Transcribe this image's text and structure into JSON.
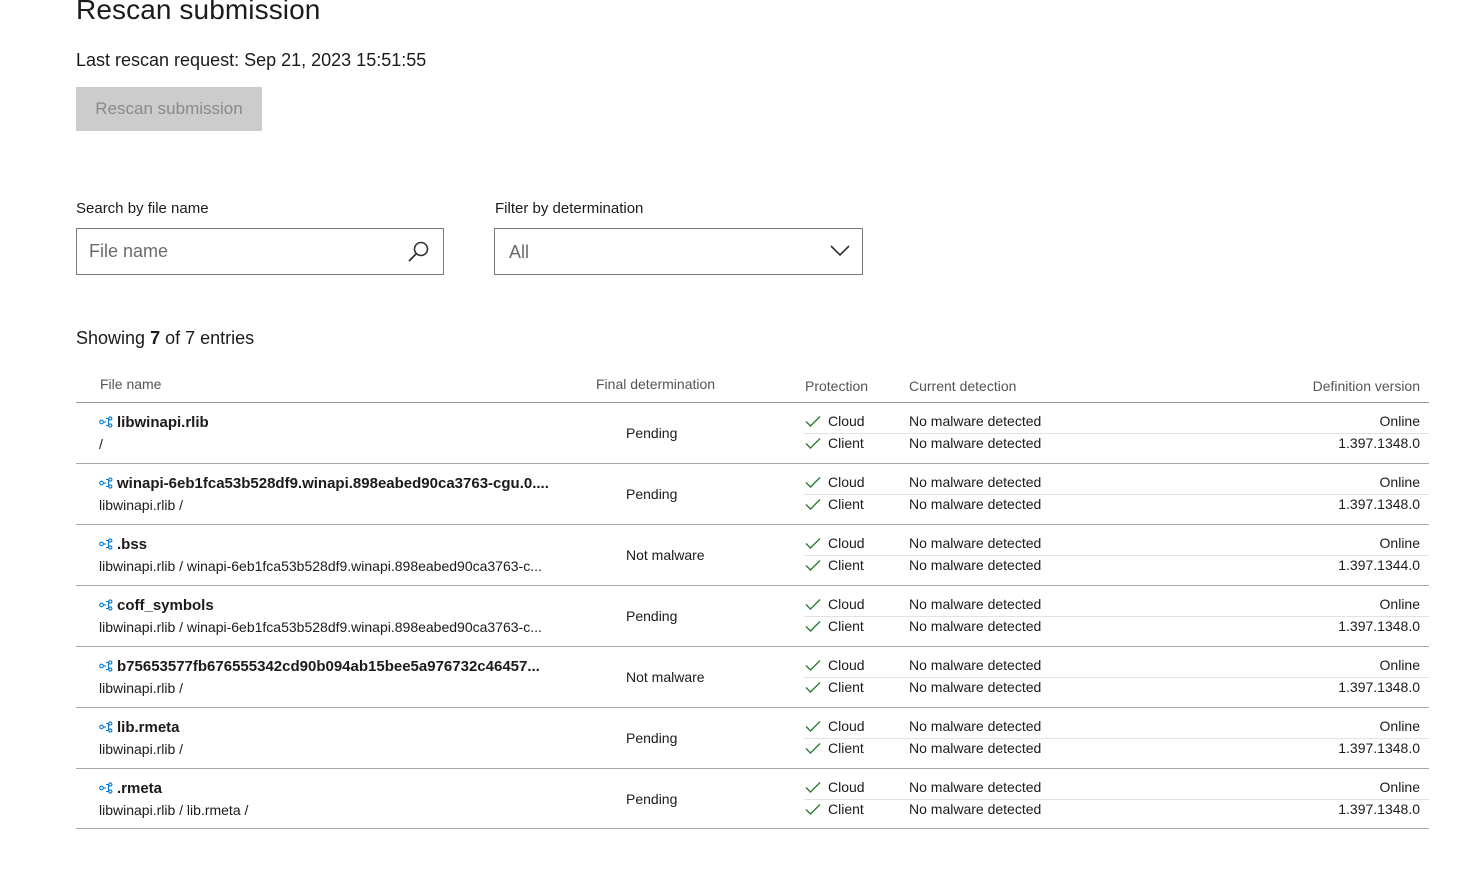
{
  "header": {
    "title": "Rescan submission",
    "last_rescan": "Last rescan request: Sep 21, 2023 15:51:55",
    "rescan_button": "Rescan submission"
  },
  "search": {
    "label": "Search by file name",
    "placeholder": "File name",
    "icon": "search-icon"
  },
  "filter": {
    "label": "Filter by determination",
    "value": "All",
    "icon": "chevron-down-icon"
  },
  "summary": {
    "prefix": "Showing",
    "shown": "7",
    "middle": "of 7 entries"
  },
  "table": {
    "columns": {
      "file_name": "File name",
      "final_determination": "Final determination",
      "protection": "Protection",
      "current_detection": "Current detection",
      "definition_version": "Definition version"
    },
    "rows": [
      {
        "name": "libwinapi.rlib",
        "path": "/",
        "determination": "Pending",
        "prot1": "Cloud",
        "prot2": "Client",
        "det1": "No malware detected",
        "det2": "No malware detected",
        "def1": "Online",
        "def2": "1.397.1348.0"
      },
      {
        "name": "winapi-6eb1fca53b528df9.winapi.898eabed90ca3763-cgu.0....",
        "path": "libwinapi.rlib /",
        "determination": "Pending",
        "prot1": "Cloud",
        "prot2": "Client",
        "det1": "No malware detected",
        "det2": "No malware detected",
        "def1": "Online",
        "def2": "1.397.1348.0"
      },
      {
        "name": ".bss",
        "path": "libwinapi.rlib / winapi-6eb1fca53b528df9.winapi.898eabed90ca3763-c...",
        "determination": "Not malware",
        "prot1": "Cloud",
        "prot2": "Client",
        "det1": "No malware detected",
        "det2": "No malware detected",
        "def1": "Online",
        "def2": "1.397.1344.0"
      },
      {
        "name": "coff_symbols",
        "path": "libwinapi.rlib / winapi-6eb1fca53b528df9.winapi.898eabed90ca3763-c...",
        "determination": "Pending",
        "prot1": "Cloud",
        "prot2": "Client",
        "det1": "No malware detected",
        "det2": "No malware detected",
        "def1": "Online",
        "def2": "1.397.1348.0"
      },
      {
        "name": "b75653577fb676555342cd90b094ab15bee5a976732c46457...",
        "path": "libwinapi.rlib /",
        "determination": "Not malware",
        "prot1": "Cloud",
        "prot2": "Client",
        "det1": "No malware detected",
        "det2": "No malware detected",
        "def1": "Online",
        "def2": "1.397.1348.0"
      },
      {
        "name": "lib.rmeta",
        "path": "libwinapi.rlib /",
        "determination": "Pending",
        "prot1": "Cloud",
        "prot2": "Client",
        "det1": "No malware detected",
        "det2": "No malware detected",
        "def1": "Online",
        "def2": "1.397.1348.0"
      },
      {
        "name": ".rmeta",
        "path": "libwinapi.rlib / lib.rmeta /",
        "determination": "Pending",
        "prot1": "Cloud",
        "prot2": "Client",
        "det1": "No malware detected",
        "det2": "No malware detected",
        "def1": "Online",
        "def2": "1.397.1348.0"
      }
    ]
  },
  "colors": {
    "check": "#2e7d32",
    "node_icon": "#0078d4",
    "disabled_button_bg": "#cccccc",
    "disabled_button_text": "#8a8a8a"
  }
}
